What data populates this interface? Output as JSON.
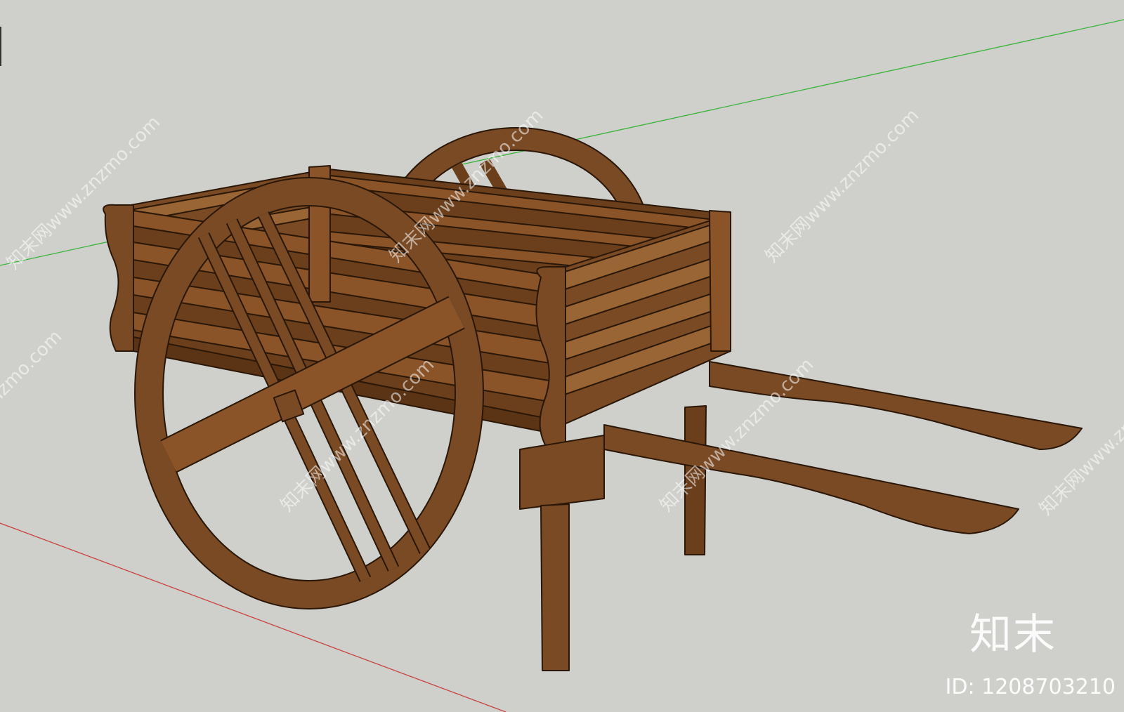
{
  "colors": {
    "background": "#cfd0cc",
    "wood": "#7a4a24",
    "wood_dark": "#4e2d12",
    "wood_light": "#9a6534",
    "outline": "#2a1708",
    "axis_green": "#3bb33b",
    "axis_red": "#c8423f"
  },
  "watermark": {
    "text": "知末网www.znzmo.com"
  },
  "brand": {
    "logo_text": "知末",
    "id_text": "ID: 1208703210"
  },
  "icons": [
    "cart-model",
    "axis-green-line",
    "axis-red-line"
  ]
}
